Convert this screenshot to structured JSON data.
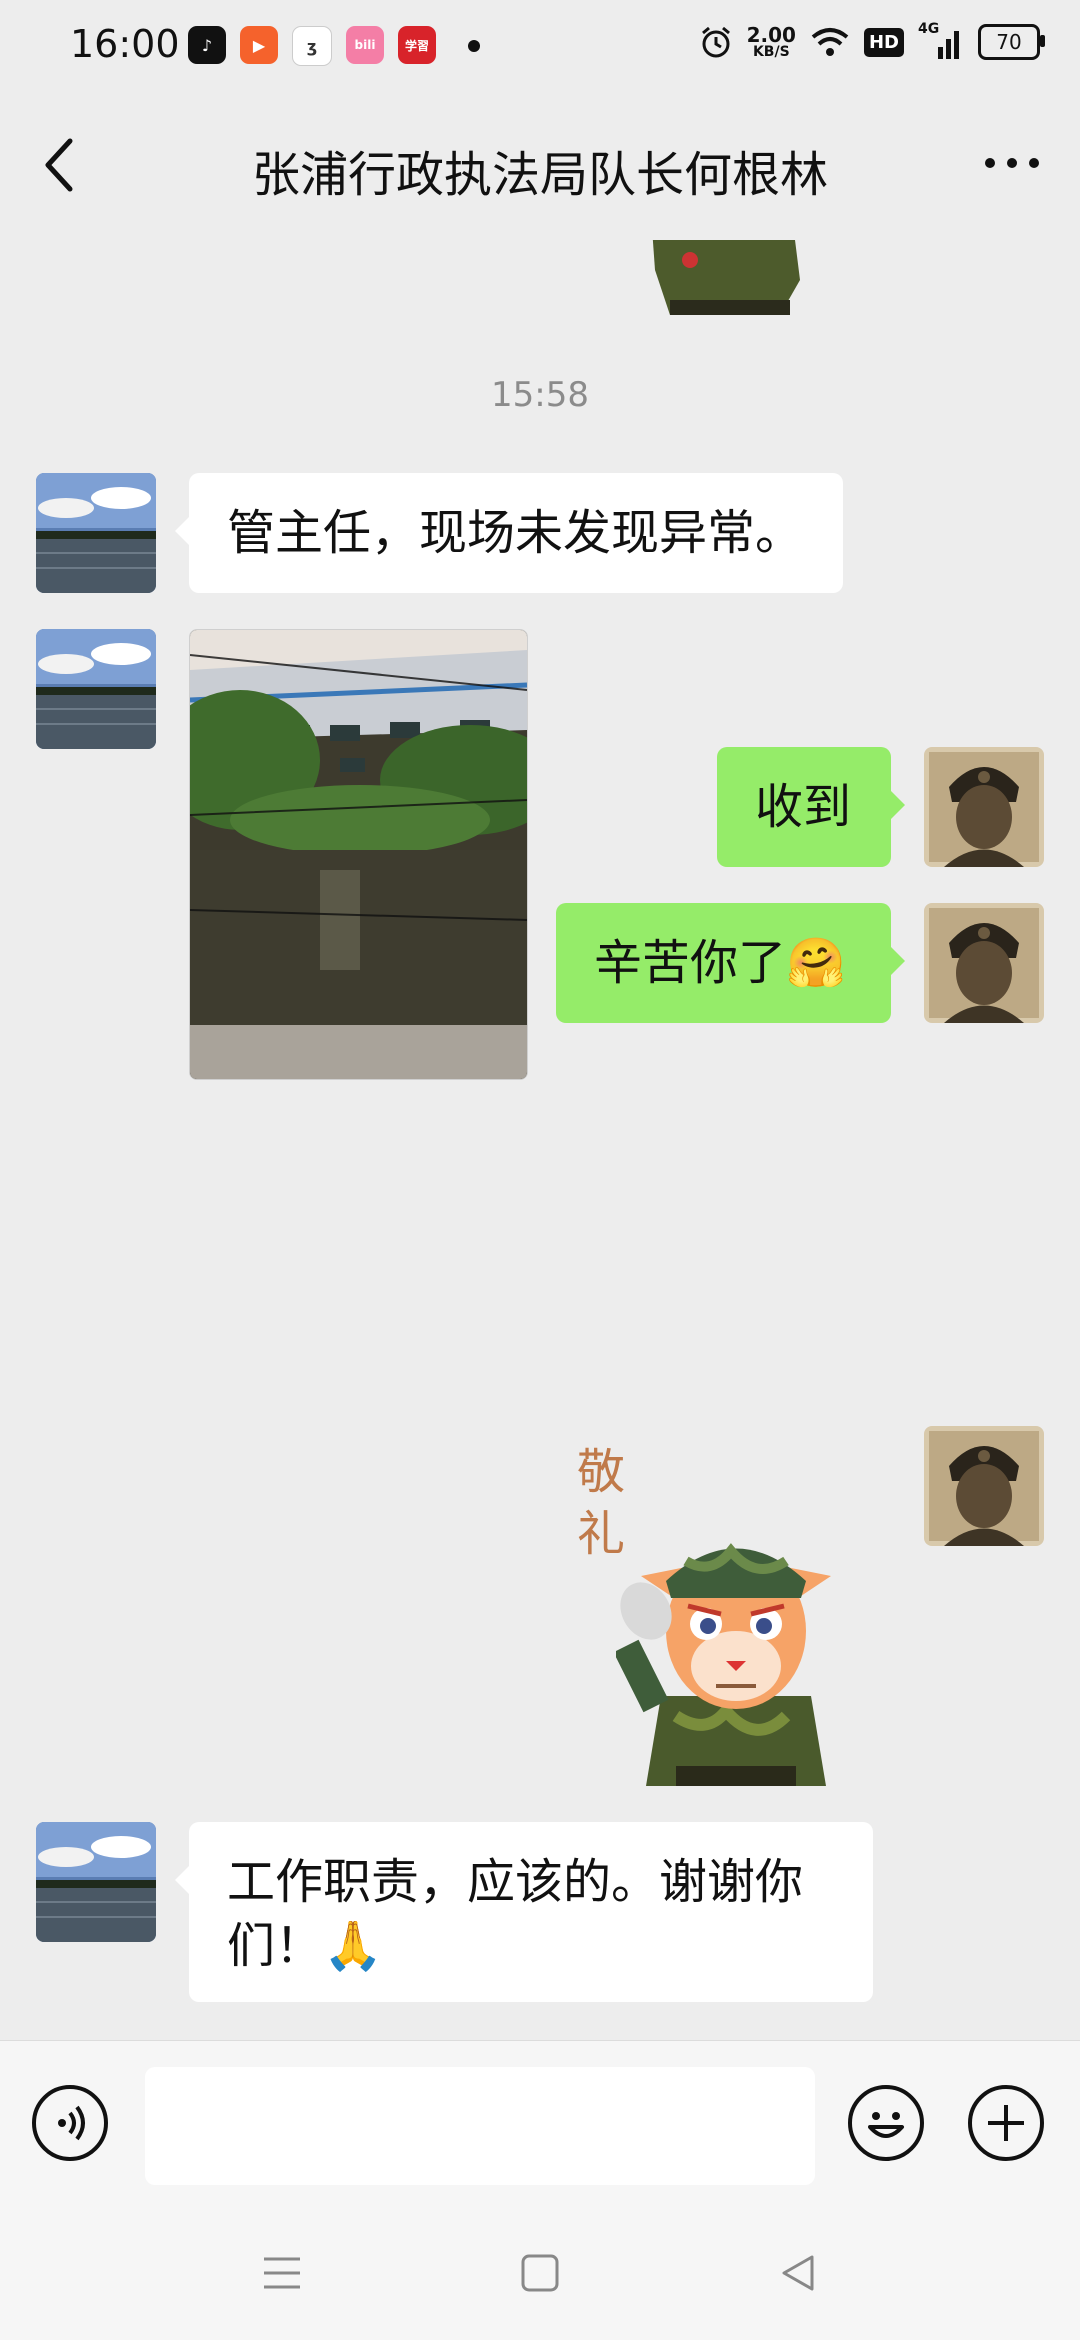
{
  "status_bar": {
    "time": "16:00",
    "apps": [
      {
        "icon": "tiktok-icon",
        "color": "#111111",
        "glyph": "♪"
      },
      {
        "icon": "kuaishou-icon",
        "color": "#f5622c",
        "glyph": "▶"
      },
      {
        "icon": "app-icon",
        "color": "#ffffff",
        "glyph": "ʒ"
      },
      {
        "icon": "bilibili-icon",
        "color": "#f47ea6",
        "glyph": "bili"
      },
      {
        "icon": "xuexi-icon",
        "color": "#d8232a",
        "glyph": "学習"
      }
    ],
    "net_speed": "2.00",
    "net_unit": "KB/S",
    "hd": "HD",
    "signal": "4G",
    "battery": "70"
  },
  "header": {
    "title": "张浦行政执法局队长何根林"
  },
  "chat": {
    "timestamp": "15:58",
    "messages": [
      {
        "side": "left",
        "type": "text",
        "text": "管主任，现场未发现异常。"
      },
      {
        "side": "left",
        "type": "image",
        "image": "river-factory-photo"
      },
      {
        "side": "right",
        "type": "text",
        "text": "收到"
      },
      {
        "side": "right",
        "type": "text",
        "text": "辛苦你了🤗"
      },
      {
        "side": "right",
        "type": "sticker",
        "sticker": "salute-sticker",
        "caption": "敬礼"
      },
      {
        "side": "left",
        "type": "text",
        "text": "工作职责，应该的。谢谢你们！🙏"
      }
    ]
  },
  "input_bar": {
    "voice_icon": "voice-icon",
    "emoji_icon": "emoji-icon",
    "plus_icon": "plus-icon"
  },
  "nav_bar": {
    "menu_icon": "menu-icon",
    "home_icon": "home-icon",
    "back_icon": "back-triangle-icon"
  }
}
